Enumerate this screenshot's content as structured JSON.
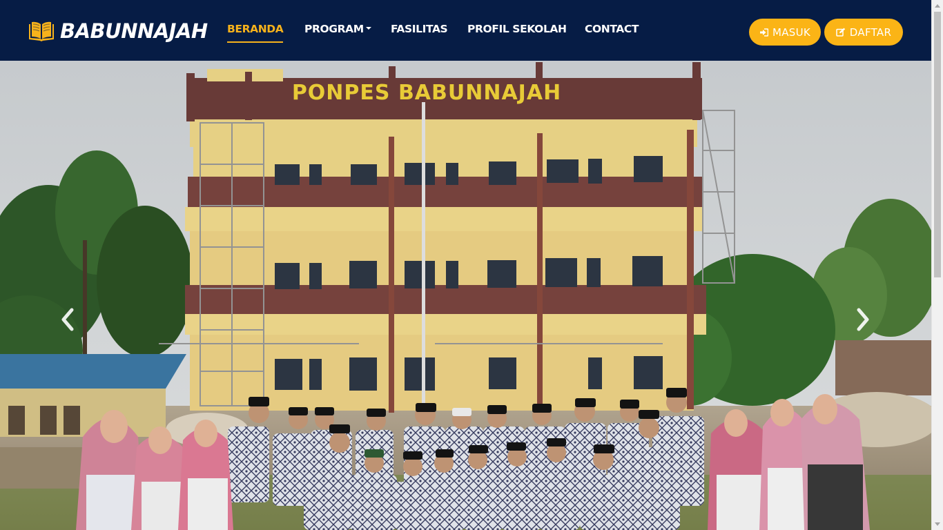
{
  "brand": {
    "name": "BABUNNAJAH",
    "icon": "open-book-icon"
  },
  "nav": {
    "items": [
      {
        "label": "BERANDA",
        "active": true
      },
      {
        "label": "PROGRAM",
        "dropdown": true
      },
      {
        "label": "FASILITAS"
      },
      {
        "label": "PROFIL SEKOLAH"
      },
      {
        "label": "CONTACT"
      }
    ]
  },
  "actions": {
    "login": {
      "label": "MASUK",
      "icon": "sign-in-icon"
    },
    "register": {
      "label": "DAFTAR",
      "icon": "edit-icon"
    }
  },
  "hero": {
    "building_sign": "PONPES BABUNNAJAH",
    "prev_icon": "chevron-left-icon",
    "next_icon": "chevron-right-icon"
  },
  "colors": {
    "navbar": "#061c45",
    "accent": "#f7b21b",
    "button": "#fbb416"
  }
}
